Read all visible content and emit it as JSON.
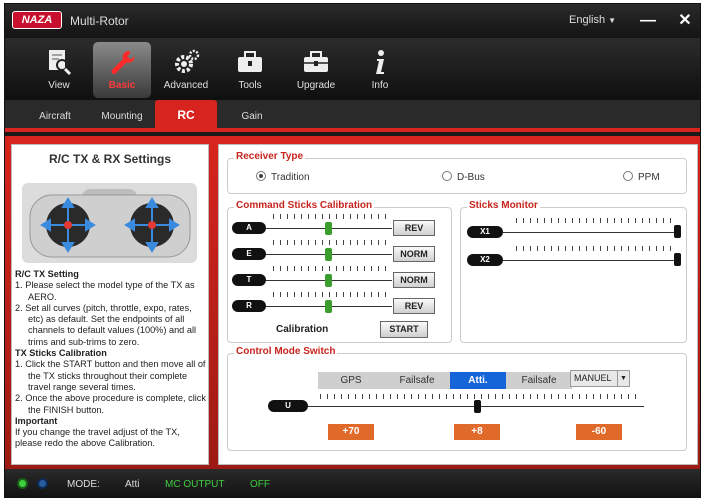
{
  "app": {
    "logo_text": "NAZA",
    "title": "Multi-Rotor",
    "language": "English",
    "minimize_glyph": "—",
    "close_glyph": "✕"
  },
  "toolbar": [
    {
      "label": "View",
      "icon": "magnifier-document-icon"
    },
    {
      "label": "Basic",
      "icon": "wrench-icon"
    },
    {
      "label": "Advanced",
      "icon": "gears-icon"
    },
    {
      "label": "Tools",
      "icon": "toolbox-icon"
    },
    {
      "label": "Upgrade",
      "icon": "upgrade-box-icon"
    },
    {
      "label": "Info",
      "icon": "info-icon"
    }
  ],
  "tabs": [
    "Aircraft",
    "Mounting",
    "RC",
    "Gain"
  ],
  "help": {
    "title": "R/C TX & RX Settings",
    "lines": [
      {
        "text": "R/C TX Setting",
        "type": "heading"
      },
      {
        "text": "1. Please select the model type of the TX as AERO.",
        "type": "item"
      },
      {
        "text": "2. Set all curves (pitch, throttle, expo, rates, etc) as default. Set the endpoints of all channels to default values (100%) and all trims and sub-trims to zero.",
        "type": "item"
      },
      {
        "text": "TX Sticks Calibration",
        "type": "heading"
      },
      {
        "text": "1. Click the START button and then move all of the TX sticks throughout their complete travel range several times.",
        "type": "item"
      },
      {
        "text": "2. Once the above procedure is complete, click the FINISH button.",
        "type": "item"
      },
      {
        "text": "Important",
        "type": "heading"
      },
      {
        "text": "If you change the travel adjust of the TX, please redo the above Calibration.",
        "type": "para"
      }
    ]
  },
  "receiver_type": {
    "label": "Receiver Type",
    "options": [
      "Tradition",
      "D-Bus",
      "PPM"
    ],
    "selected": "Tradition"
  },
  "calibration": {
    "label": "Command Sticks Calibration",
    "channels": [
      {
        "name": "A",
        "button": "REV",
        "level": 0.5
      },
      {
        "name": "E",
        "button": "NORM",
        "level": 0.5
      },
      {
        "name": "T",
        "button": "NORM",
        "level": 0.5
      },
      {
        "name": "R",
        "button": "REV",
        "level": 0.5
      }
    ],
    "caption": "Calibration",
    "start_label": "START"
  },
  "sticks_monitor": {
    "label": "Sticks Monitor",
    "channels": [
      {
        "name": "X1",
        "level": 1.0
      },
      {
        "name": "X2",
        "level": 1.0
      }
    ]
  },
  "control_mode": {
    "label": "Control Mode Switch",
    "segments": [
      "GPS",
      "Failsafe",
      "Atti.",
      "Failsafe"
    ],
    "active": "Atti.",
    "manual_select": "MANUEL",
    "channel": "U",
    "level": 0.5,
    "values": [
      "+70",
      "+8",
      "-60"
    ]
  },
  "status": {
    "mode_label": "MODE:",
    "mode_value": "Atti",
    "output_label": "MC OUTPUT",
    "output_value": "OFF"
  },
  "colors": {
    "accent_red": "#d8241e",
    "mode_blue": "#1565d8",
    "value_orange": "#e06a2a",
    "status_green": "#3ecf3e"
  }
}
